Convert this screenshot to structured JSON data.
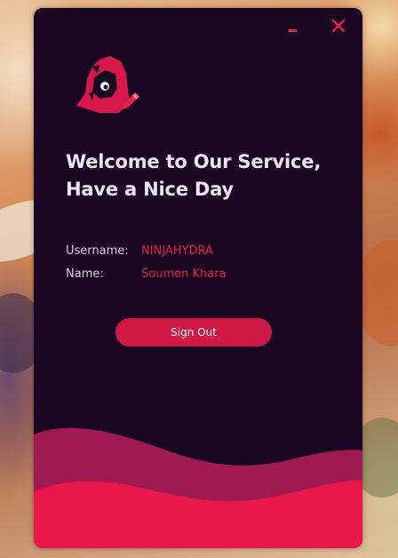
{
  "window": {
    "controls": {
      "minimize_icon": "minimize-icon",
      "close_icon": "close-icon"
    },
    "logo_icon": "hooded-ninja-with-pencil-icon"
  },
  "welcome": {
    "line1": "Welcome to Our Service,",
    "line2": "Have a Nice Day"
  },
  "info": {
    "username_label": "Username:",
    "username_value": "NINJAHYDRA",
    "name_label": "Name:",
    "name_value": "Soumen Khara"
  },
  "actions": {
    "signout_label": "Sign Out"
  },
  "colors": {
    "background": "#1a0522",
    "accent": "#e3204a",
    "button": "#cf1844",
    "wave_dark": "#a01a52",
    "wave_light": "#e8184a",
    "text": "#ece6f0"
  }
}
